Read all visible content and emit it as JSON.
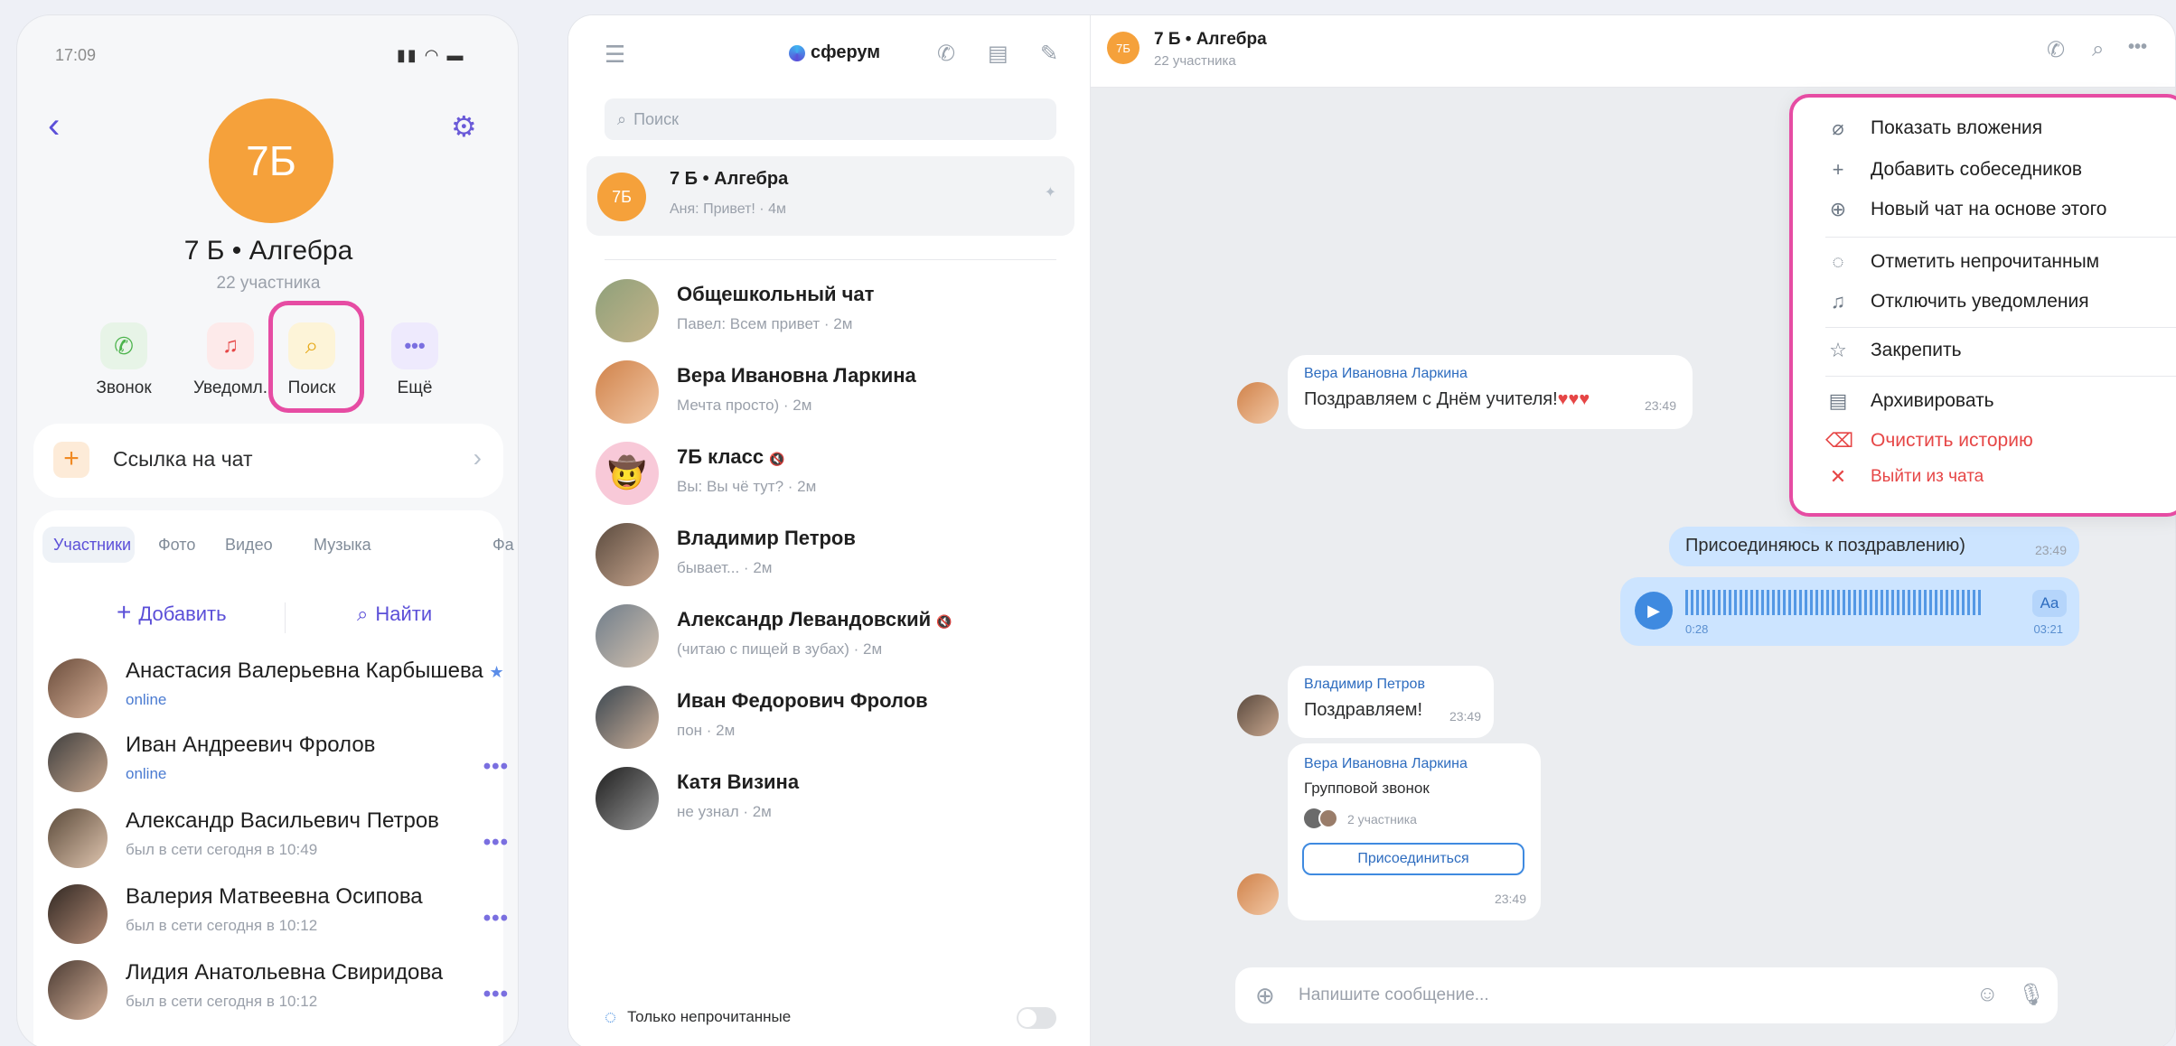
{
  "phone": {
    "status_time": "17:09",
    "group_avatar": "7Б",
    "group_title": "7 Б • Алгебра",
    "group_members": "22 участника",
    "actions": [
      {
        "label": "Звонок",
        "icon": "phone-icon",
        "color": "#4bb34b",
        "bg": "#e7f4e7"
      },
      {
        "label": "Уведомл.",
        "icon": "bell-icon",
        "color": "#e64646",
        "bg": "#fdeaea"
      },
      {
        "label": "Поиск",
        "icon": "search-icon",
        "color": "#e6a817",
        "bg": "#fdf4d8"
      },
      {
        "label": "Ещё",
        "icon": "more-icon",
        "color": "#7a6fe0",
        "bg": "#eeeafd"
      }
    ],
    "chat_link": "Ссылка на чат",
    "tabs": [
      "Участники",
      "Фото",
      "Видео",
      "Музыка",
      "Фа"
    ],
    "add_label": "Добавить",
    "find_label": "Найти",
    "members": [
      {
        "name": "Анастасия Валерьевна Карбышева",
        "status": "online",
        "star": "★"
      },
      {
        "name": "Иван Андреевич Фролов",
        "status": "online"
      },
      {
        "name": "Александр Васильевич Петров",
        "status": "был в сети сегодня в 10:49"
      },
      {
        "name": "Валерия Матвеевна Осипова",
        "status": "был в сети сегодня в 10:12"
      },
      {
        "name": "Лидия Анатольевна Свиридова",
        "status": "был в сети сегодня в 10:12"
      }
    ]
  },
  "desktop": {
    "brand": "сферум",
    "search_placeholder": "Поиск",
    "chats": [
      {
        "name": "7 Б • Алгебра",
        "preview": "Аня: Привет! · 4м",
        "avatar": "7Б"
      },
      {
        "name": "Общешкольный чат",
        "preview": "Павел: Всем привет · 2м"
      },
      {
        "name": "Вера Ивановна Ларкина",
        "preview": "Мечта просто) · 2м"
      },
      {
        "name": "7Б класс",
        "preview": "Вы: Вы чё тут? · 2м"
      },
      {
        "name": "Владимир Петров",
        "preview": "бывает... · 2м"
      },
      {
        "name": "Александр Левандовский",
        "preview": "(читаю с пищей в зубах) · 2м"
      },
      {
        "name": "Иван Федорович Фролов",
        "preview": "пон · 2м"
      },
      {
        "name": "Катя Визина",
        "preview": "не узнал · 2м"
      }
    ],
    "unread_only": "Только непрочитанные",
    "header_title": "7 Б • Алгебра",
    "header_sub": "22 участника",
    "header_avatar": "7Б",
    "messages": {
      "m1_author": "Вера Ивановна Ларкина",
      "m1_text": "Поздравляем с Днём учителя!",
      "m1_hearts": "♥♥♥",
      "m1_time": "23:49",
      "m2_text": "Присоединяюсь к поздравлению)",
      "m2_time": "23:49",
      "voice_start": "0:28",
      "voice_end": "03:21",
      "voice_aa": "Aa",
      "m3_author": "Владимир Петров",
      "m3_text": "Поздравляем!",
      "m3_time": "23:49",
      "m4_author": "Вера Ивановна Ларкина",
      "m4_text": "Групповой звонок",
      "m4_participants": "2 участника",
      "m4_join": "Присоединиться",
      "m4_time": "23:49"
    },
    "composer_placeholder": "Напишите сообщение...",
    "menu": [
      {
        "label": "Показать вложения",
        "icon": "paperclip-icon",
        "glyph": "⌀"
      },
      {
        "label": "Добавить собеседников",
        "icon": "plus-icon",
        "glyph": "+"
      },
      {
        "label": "Новый чат на основе этого",
        "icon": "new-chat-icon",
        "glyph": "⊕"
      },
      {
        "label": "Отметить непрочитанным",
        "icon": "unread-icon",
        "glyph": "◌"
      },
      {
        "label": "Отключить уведомления",
        "icon": "bell-off-icon",
        "glyph": "🔕"
      },
      {
        "label": "Закрепить",
        "icon": "pin-icon",
        "glyph": "☆"
      },
      {
        "label": "Архивировать",
        "icon": "archive-icon",
        "glyph": "▤"
      },
      {
        "label": "Очистить историю",
        "icon": "trash-icon",
        "glyph": "🗑",
        "danger": true
      },
      {
        "label": "Выйти из чата",
        "icon": "exit-icon",
        "glyph": "✕",
        "danger": true
      }
    ]
  }
}
